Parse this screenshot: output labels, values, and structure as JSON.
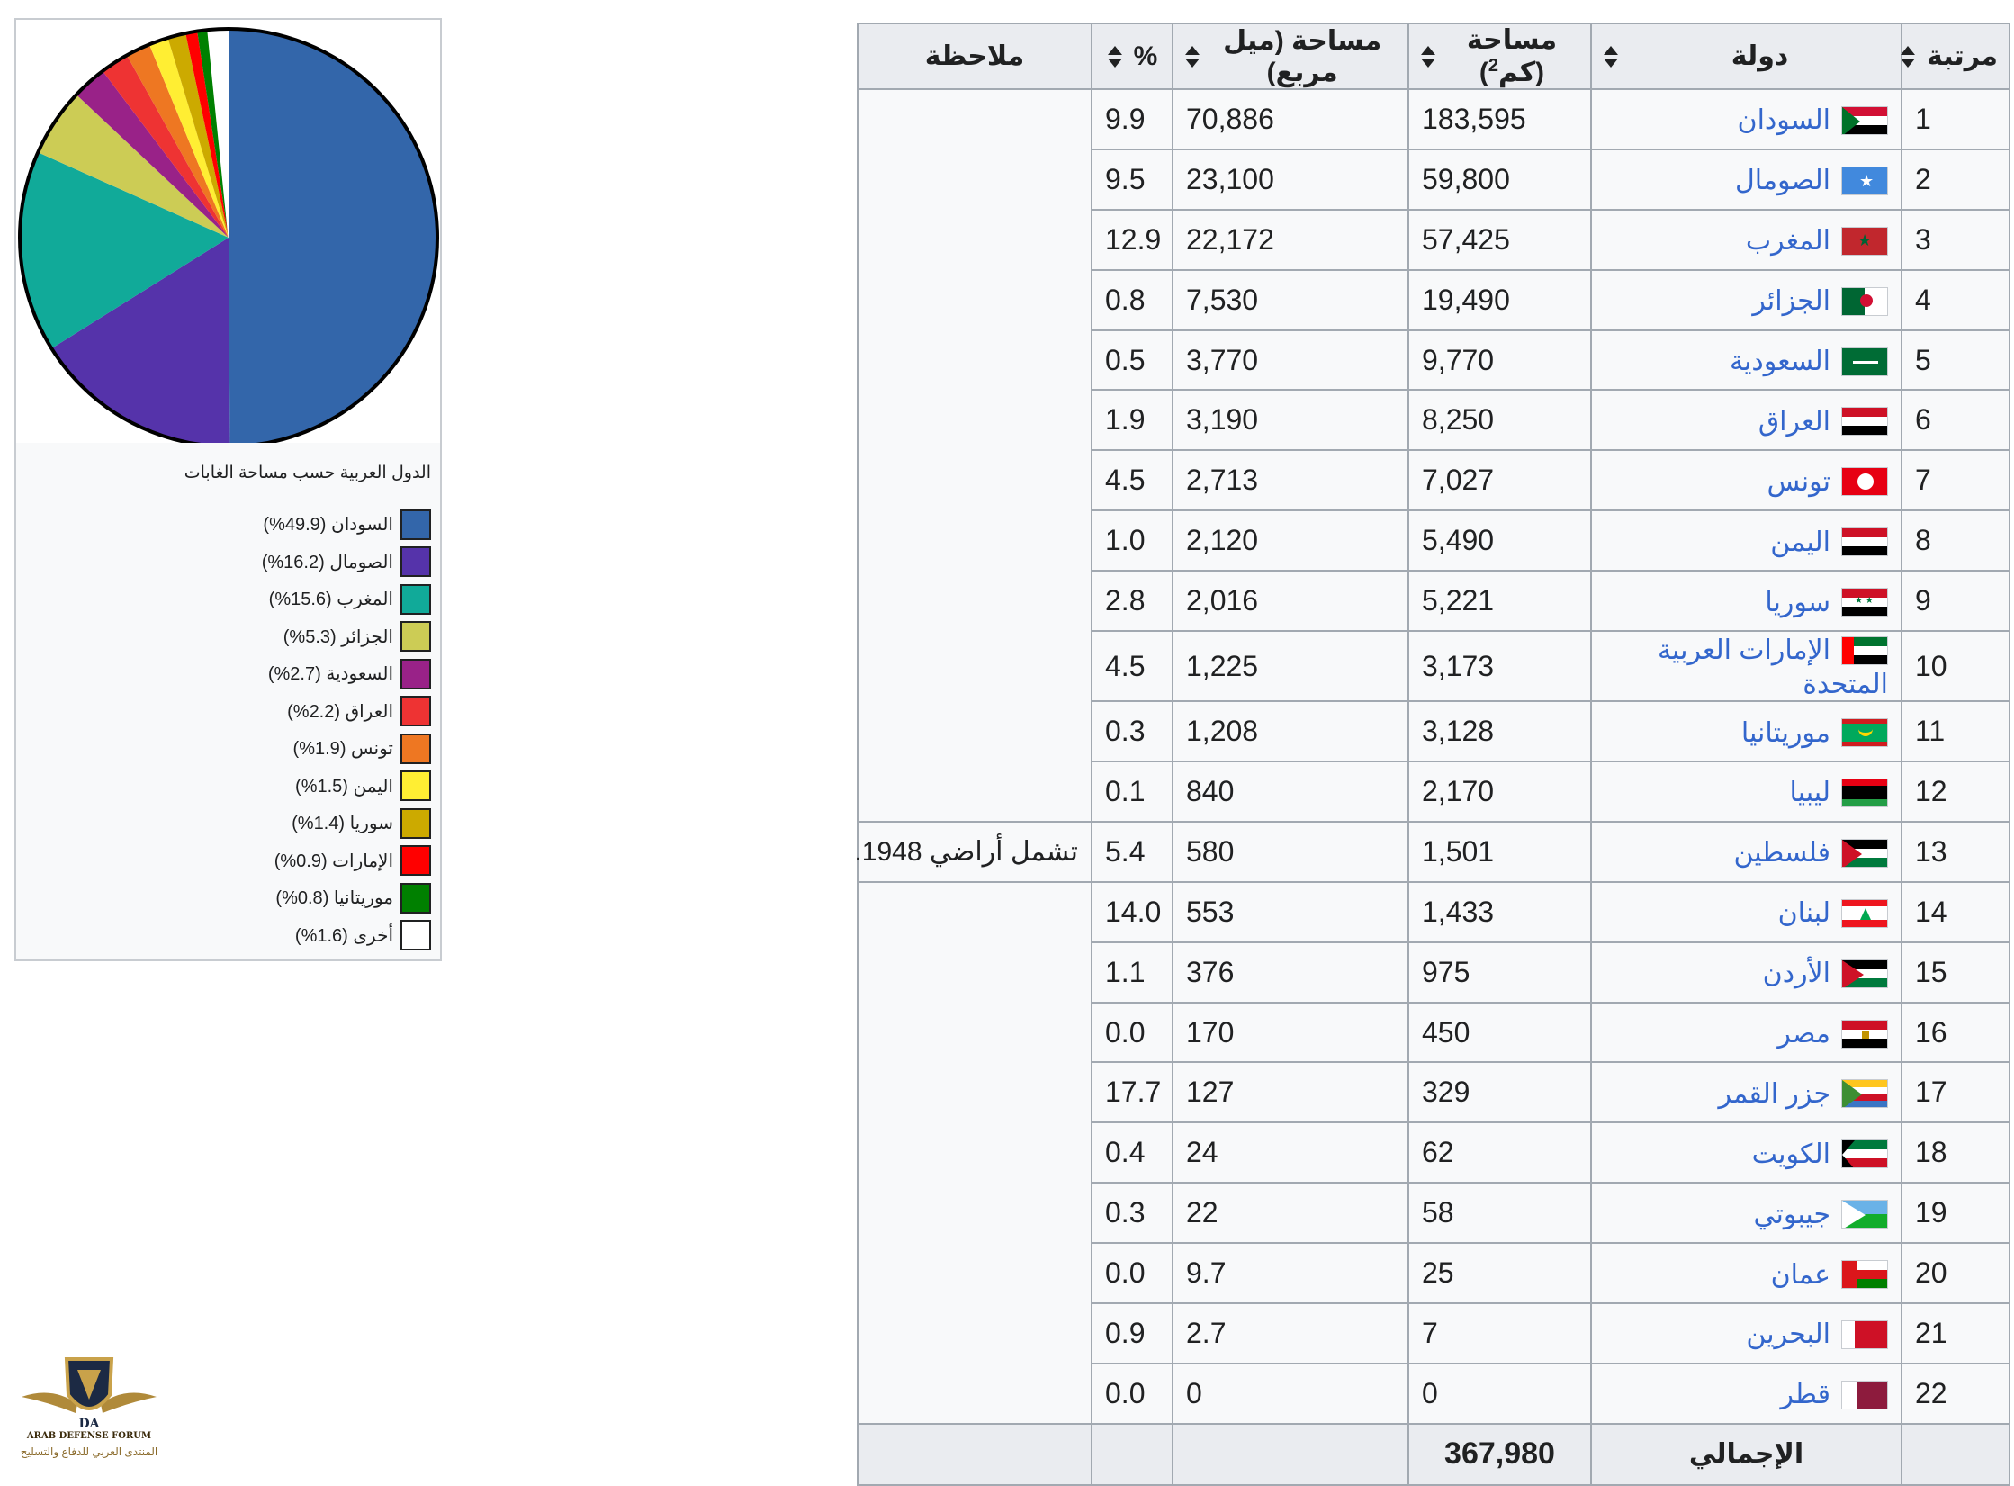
{
  "table": {
    "headers": {
      "rank": "مرتبة",
      "country": "دولة",
      "area_km2": "مساحة (كم",
      "area_km2_sup": "2",
      "area_mi2": "مساحة (ميل مربع)",
      "percent": "%",
      "note": "ملاحظة"
    },
    "rows": [
      {
        "rank": "1",
        "country": "السودان",
        "km2": "183,595",
        "mi2": "70,886",
        "pct": "9.9",
        "flag": "sudan"
      },
      {
        "rank": "2",
        "country": "الصومال",
        "km2": "59,800",
        "mi2": "23,100",
        "pct": "9.5",
        "flag": "somalia"
      },
      {
        "rank": "3",
        "country": "المغرب",
        "km2": "57,425",
        "mi2": "22,172",
        "pct": "12.9",
        "flag": "morocco"
      },
      {
        "rank": "4",
        "country": "الجزائر",
        "km2": "19,490",
        "mi2": "7,530",
        "pct": "0.8",
        "flag": "algeria"
      },
      {
        "rank": "5",
        "country": "السعودية",
        "km2": "9,770",
        "mi2": "3,770",
        "pct": "0.5",
        "flag": "saudi"
      },
      {
        "rank": "6",
        "country": "العراق",
        "km2": "8,250",
        "mi2": "3,190",
        "pct": "1.9",
        "flag": "iraq"
      },
      {
        "rank": "7",
        "country": "تونس",
        "km2": "7,027",
        "mi2": "2,713",
        "pct": "4.5",
        "flag": "tunisia"
      },
      {
        "rank": "8",
        "country": "اليمن",
        "km2": "5,490",
        "mi2": "2,120",
        "pct": "1.0",
        "flag": "yemen"
      },
      {
        "rank": "9",
        "country": "سوريا",
        "km2": "5,221",
        "mi2": "2,016",
        "pct": "2.8",
        "flag": "syria"
      },
      {
        "rank": "10",
        "country": "الإمارات العربية المتحدة",
        "km2": "3,173",
        "mi2": "1,225",
        "pct": "4.5",
        "flag": "uae"
      },
      {
        "rank": "11",
        "country": "موريتانيا",
        "km2": "3,128",
        "mi2": "1,208",
        "pct": "0.3",
        "flag": "mauritania"
      },
      {
        "rank": "12",
        "country": "ليبيا",
        "km2": "2,170",
        "mi2": "840",
        "pct": "0.1",
        "flag": "libya"
      },
      {
        "rank": "13",
        "country": "فلسطين",
        "km2": "1,501",
        "mi2": "580",
        "pct": "5.4",
        "flag": "palestine",
        "note": "تشمل أراضي 1948."
      },
      {
        "rank": "14",
        "country": "لبنان",
        "km2": "1,433",
        "mi2": "553",
        "pct": "14.0",
        "flag": "lebanon"
      },
      {
        "rank": "15",
        "country": "الأردن",
        "km2": "975",
        "mi2": "376",
        "pct": "1.1",
        "flag": "jordan"
      },
      {
        "rank": "16",
        "country": "مصر",
        "km2": "450",
        "mi2": "170",
        "pct": "0.0",
        "flag": "egypt"
      },
      {
        "rank": "17",
        "country": "جزر القمر",
        "km2": "329",
        "mi2": "127",
        "pct": "17.7",
        "flag": "comoros"
      },
      {
        "rank": "18",
        "country": "الكويت",
        "km2": "62",
        "mi2": "24",
        "pct": "0.4",
        "flag": "kuwait"
      },
      {
        "rank": "19",
        "country": "جيبوتي",
        "km2": "58",
        "mi2": "22",
        "pct": "0.3",
        "flag": "djibouti"
      },
      {
        "rank": "20",
        "country": "عمان",
        "km2": "25",
        "mi2": "9.7",
        "pct": "0.0",
        "flag": "oman"
      },
      {
        "rank": "21",
        "country": "البحرين",
        "km2": "7",
        "mi2": "2.7",
        "pct": "0.9",
        "flag": "bahrain"
      },
      {
        "rank": "22",
        "country": "قطر",
        "km2": "0",
        "mi2": "0",
        "pct": "0.0",
        "flag": "qatar"
      }
    ],
    "total_label": "الإجمالي",
    "total_value": "367,980"
  },
  "chart_data": {
    "type": "pie",
    "title": "الدول العربية حسب مساحة الغابات",
    "slices": [
      {
        "label": "السودان (49.9%)",
        "value": 49.9,
        "color": "#3366aa"
      },
      {
        "label": "الصومال (16.2%)",
        "value": 16.2,
        "color": "#5533aa"
      },
      {
        "label": "المغرب (15.6%)",
        "value": 15.6,
        "color": "#11aa99"
      },
      {
        "label": "الجزائر (5.3%)",
        "value": 5.3,
        "color": "#cccc55"
      },
      {
        "label": "السعودية (2.7%)",
        "value": 2.7,
        "color": "#992288"
      },
      {
        "label": "العراق (2.2%)",
        "value": 2.2,
        "color": "#ee3333"
      },
      {
        "label": "تونس (1.9%)",
        "value": 1.9,
        "color": "#ee7722"
      },
      {
        "label": "اليمن (1.5%)",
        "value": 1.5,
        "color": "#ffee33"
      },
      {
        "label": "سوريا (1.4%)",
        "value": 1.4,
        "color": "#ccaa00"
      },
      {
        "label": "الإمارات (0.9%)",
        "value": 0.9,
        "color": "#ff0000"
      },
      {
        "label": "موريتانيا (0.8%)",
        "value": 0.8,
        "color": "#008000"
      },
      {
        "label": "أخرى (1.6%)",
        "value": 1.6,
        "color": "#ffffff"
      }
    ]
  },
  "logo": {
    "line1": "ARAB DEFENSE FORUM",
    "line2": "المنتدى العربي للدفاع والتسليح"
  }
}
